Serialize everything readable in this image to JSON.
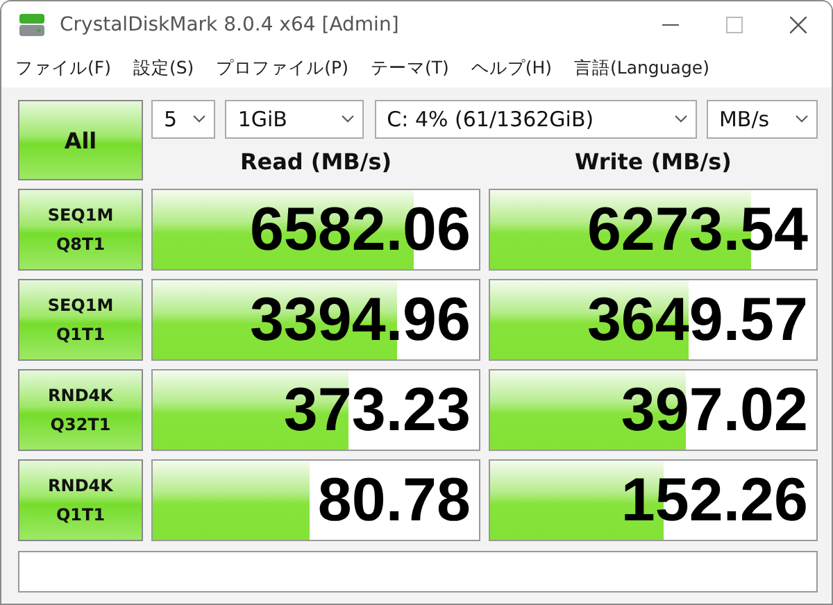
{
  "window": {
    "title": "CrystalDiskMark 8.0.4 x64 [Admin]"
  },
  "menu": [
    "ファイル(F)",
    "設定(S)",
    "プロファイル(P)",
    "テーマ(T)",
    "ヘルプ(H)",
    "言語(Language)"
  ],
  "all_button": "All",
  "selectors": [
    {
      "value": "5"
    },
    {
      "value": "1GiB"
    },
    {
      "value": "C: 4% (61/1362GiB)"
    },
    {
      "value": "MB/s"
    }
  ],
  "columns": [
    "Read (MB/s)",
    "Write (MB/s)"
  ],
  "rows": [
    {
      "test": [
        "SEQ1M",
        "Q8T1"
      ],
      "read": {
        "value": "6582.06",
        "level": 0.8
      },
      "write": {
        "value": "6273.54",
        "level": 0.8
      }
    },
    {
      "test": [
        "SEQ1M",
        "Q1T1"
      ],
      "read": {
        "value": "3394.96",
        "level": 0.75
      },
      "write": {
        "value": "3649.57",
        "level": 0.61
      }
    },
    {
      "test": [
        "RND4K",
        "Q32T1"
      ],
      "read": {
        "value": "373.23",
        "level": 0.6
      },
      "write": {
        "value": "397.02",
        "level": 0.6
      }
    },
    {
      "test": [
        "RND4K",
        "Q1T1"
      ],
      "read": {
        "value": "80.78",
        "level": 0.48
      },
      "write": {
        "value": "152.26",
        "level": 0.53
      }
    }
  ]
}
